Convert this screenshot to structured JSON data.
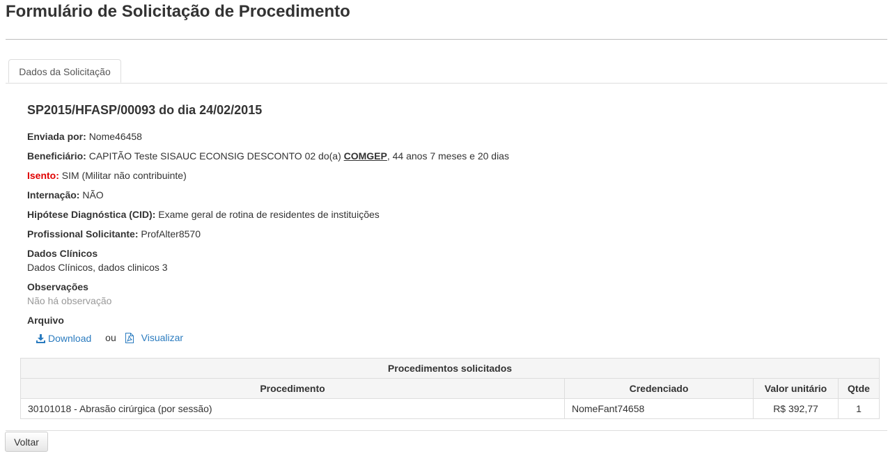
{
  "page": {
    "title": "Formulário de Solicitação de Procedimento"
  },
  "tabs": [
    {
      "label": "Dados da Solicitação",
      "active": true
    }
  ],
  "request": {
    "heading": "SP2015/HFASP/00093 do dia 24/02/2015",
    "sent_by": {
      "label": "Enviada por:",
      "value": "Nome46458"
    },
    "beneficiary": {
      "label": "Beneficiário:",
      "value_prefix": "CAPITÃO Teste SISAUC ECONSIG DESCONTO 02 do(a)",
      "org": "COMGEP",
      "value_suffix": ", 44 anos 7 meses e 20 dias"
    },
    "exempt": {
      "label": "Isento:",
      "value": "SIM (Militar não contribuinte)"
    },
    "hospitalization": {
      "label": "Internação:",
      "value": "NÃO"
    },
    "diagnosis": {
      "label": "Hipótese Diagnóstica (CID):",
      "value": "Exame geral de rotina de residentes de instituições"
    },
    "requester": {
      "label": "Profissional Solicitante:",
      "value": "ProfAlter8570"
    },
    "clinical": {
      "label": "Dados Clínicos",
      "value": "Dados Clínicos, dados clinicos 3"
    },
    "observations": {
      "label": "Observações",
      "value": "Não há observação"
    },
    "file": {
      "label": "Arquivo",
      "download": "Download",
      "or": "ou",
      "view": "Visualizar"
    }
  },
  "procedures": {
    "title": "Procedimentos solicitados",
    "headers": [
      "Procedimento",
      "Credenciado",
      "Valor unitário",
      "Qtde"
    ],
    "rows": [
      {
        "procedure": "30101018 - Abrasão cirúrgica (por sessão)",
        "provider": "NomeFant74658",
        "unit_value": "R$ 392,77",
        "qty": "1"
      }
    ]
  },
  "actions": {
    "back": "Voltar"
  },
  "colors": {
    "link": "#2a7bbf",
    "exempt_label": "#e00000",
    "muted": "#999999"
  },
  "icons": {
    "download": "download-icon",
    "view": "pdf-file-icon"
  }
}
